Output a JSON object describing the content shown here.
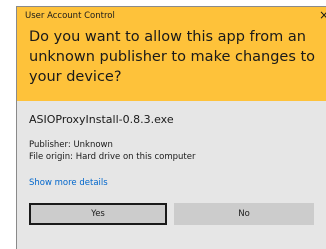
{
  "dialog": {
    "window_title": "User Account Control",
    "close_glyph": "×",
    "question": "Do you want to allow this app from an unknown publisher to make changes to your device?",
    "program_name": "ASIOProxyInstall-0.8.3.exe",
    "publisher_line": "Publisher: Unknown",
    "origin_line": "File origin: Hard drive on this computer",
    "details_link": "Show more details",
    "yes_label": "Yes",
    "no_label": "No"
  },
  "colors": {
    "header_bg": "#fec23a",
    "body_bg": "#e6e6e6",
    "link": "#0066cc",
    "button_bg": "#cccccc"
  },
  "icons": {
    "close": "close-icon"
  }
}
